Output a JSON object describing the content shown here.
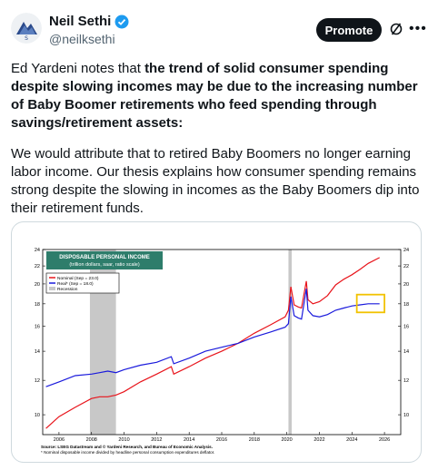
{
  "author": {
    "name": "Neil Sethi",
    "handle": "@neilksethi",
    "verified": true
  },
  "actions": {
    "promote_label": "Promote",
    "icons": [
      "slash-circle-icon",
      "more-icon"
    ]
  },
  "tweet": {
    "p1_plain": "Ed Yardeni notes that ",
    "p1_bold": "the trend of solid consumer spending despite slowing incomes may be due to the increasing number of Baby Boomer retirements who feed spending through savings/retirement assets:",
    "p2": "We would attribute that to retired Baby Boomers no longer earning labor income. Our thesis explains how consumer spending remains strong despite the slowing in incomes as the Baby Boomers dip into their retirement funds."
  },
  "colors": {
    "nominal": "#e8141b",
    "real": "#1a1adc",
    "recession": "#c8c8c8",
    "title_box": "#2e7d6b",
    "highlight_box": "#f2c200"
  },
  "chart_data": {
    "type": "line",
    "title": "DISPOSABLE PERSONAL INCOME",
    "subtitle": "(trillion dollars, saar, ratio scale)",
    "x_ticks": [
      "2006",
      "2008",
      "2010",
      "2012",
      "2014",
      "2016",
      "2018",
      "2020",
      "2022",
      "2024",
      "2026"
    ],
    "y_ticks": [
      "24",
      "22",
      "20",
      "18",
      "16",
      "14",
      "12",
      "10"
    ],
    "xlim": [
      2005,
      2027
    ],
    "ylim": [
      9,
      24
    ],
    "log_scale": true,
    "legend_placement": "top-left",
    "recessions": [
      [
        2007.9,
        2009.5
      ],
      [
        2020.1,
        2020.3
      ]
    ],
    "series": [
      {
        "name": "Nominal (Sep = 23.0)",
        "x": [
          2005.2,
          2006,
          2007,
          2008,
          2008.5,
          2009,
          2009.5,
          2010,
          2011,
          2012,
          2012.9,
          2013.05,
          2014,
          2015,
          2016,
          2017,
          2018,
          2019,
          2019.9,
          2020.1,
          2020.25,
          2020.45,
          2020.7,
          2020.9,
          2021.2,
          2021.3,
          2021.6,
          2022,
          2022.5,
          2023,
          2023.5,
          2024,
          2024.5,
          2025,
          2025.7
        ],
        "y": [
          9.3,
          9.9,
          10.4,
          10.9,
          11.0,
          11.0,
          11.1,
          11.3,
          11.9,
          12.4,
          12.9,
          12.4,
          12.9,
          13.5,
          14.0,
          14.6,
          15.4,
          16.1,
          16.8,
          17.4,
          19.7,
          17.9,
          17.7,
          17.6,
          20.3,
          18.4,
          18.0,
          18.2,
          18.8,
          19.9,
          20.5,
          21.0,
          21.6,
          22.3,
          23.0
        ]
      },
      {
        "name": "Real* (Sep = 18.0)",
        "x": [
          2005.2,
          2006,
          2007,
          2008,
          2008.5,
          2009,
          2009.5,
          2010,
          2011,
          2012,
          2012.9,
          2013.05,
          2014,
          2015,
          2016,
          2017,
          2018,
          2019,
          2019.9,
          2020.1,
          2020.25,
          2020.45,
          2020.7,
          2020.9,
          2021.2,
          2021.3,
          2021.6,
          2022,
          2022.5,
          2023,
          2023.5,
          2024,
          2024.5,
          2025,
          2025.7
        ],
        "y": [
          11.6,
          11.9,
          12.3,
          12.4,
          12.5,
          12.6,
          12.5,
          12.7,
          13.0,
          13.2,
          13.6,
          13.1,
          13.5,
          14.0,
          14.3,
          14.6,
          15.1,
          15.5,
          15.9,
          16.2,
          18.7,
          16.9,
          16.7,
          16.6,
          19.5,
          17.4,
          16.9,
          16.8,
          17.0,
          17.4,
          17.6,
          17.8,
          17.9,
          18.0,
          18.0
        ]
      }
    ],
    "legend_title": "Recession",
    "source": "Source: LSEG Datastream and © Yardeni Research, and Bureau of Economic Analysis.",
    "footnote": "* Nominal disposable income divided by headline personal consumption expenditures deflator."
  }
}
